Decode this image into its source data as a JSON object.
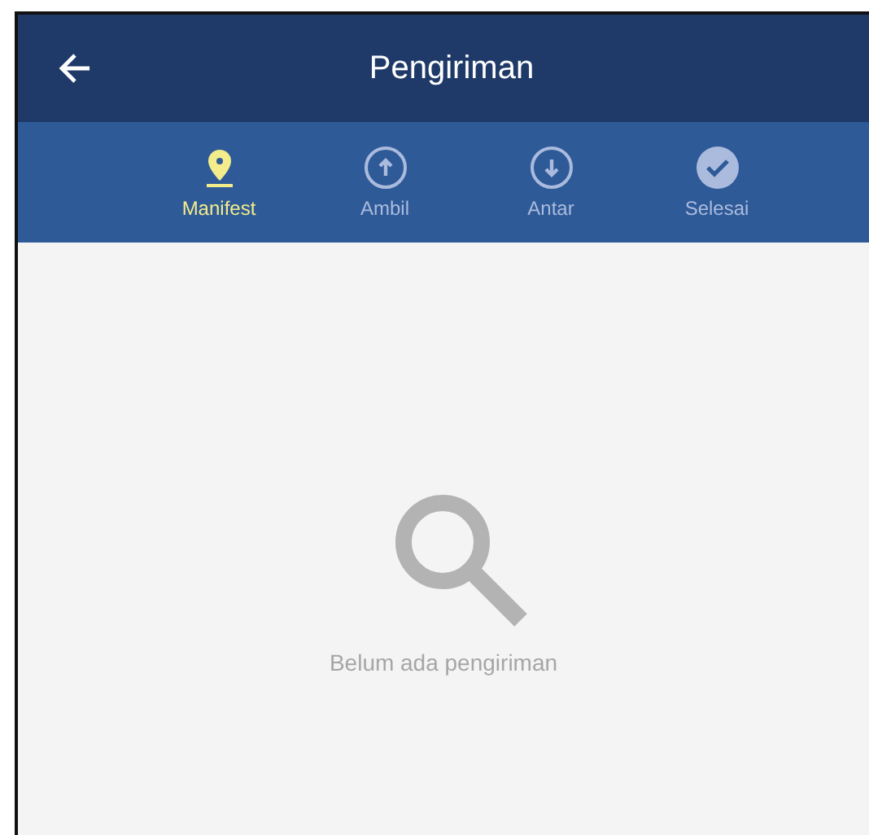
{
  "header": {
    "title": "Pengiriman"
  },
  "tabs": [
    {
      "label": "Manifest",
      "kind": "pin",
      "selected": true
    },
    {
      "label": "Ambil",
      "kind": "up",
      "selected": false
    },
    {
      "label": "Antar",
      "kind": "down",
      "selected": false
    },
    {
      "label": "Selesai",
      "kind": "done",
      "selected": false
    }
  ],
  "empty_state": {
    "message": "Belum ada pengiriman"
  }
}
